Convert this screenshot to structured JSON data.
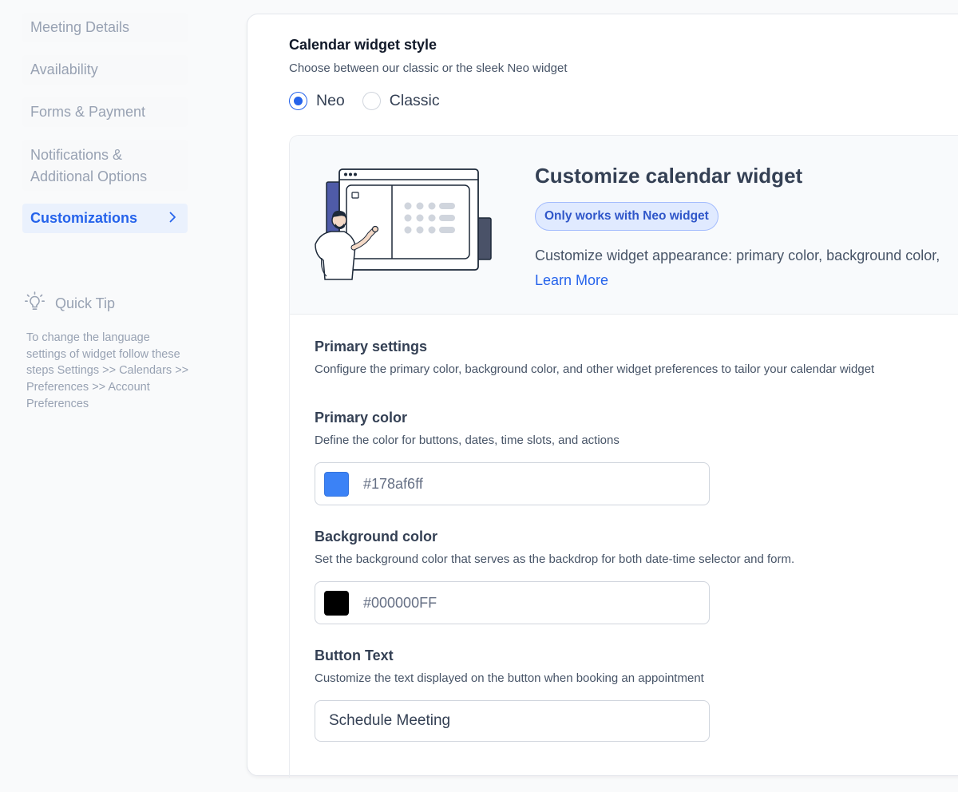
{
  "sidebar": {
    "items": [
      {
        "label": "Meeting Details"
      },
      {
        "label": "Availability"
      },
      {
        "label": "Forms & Payment"
      },
      {
        "label_line1": "Notifications &",
        "label_line2": "Additional Options"
      },
      {
        "label": "Customizations",
        "active": true
      }
    ]
  },
  "quick_tip": {
    "title": "Quick Tip",
    "body": "To change the language settings of widget follow these steps Settings >> Calendars >> Preferences >> Account Preferences"
  },
  "widget_style": {
    "title": "Calendar widget style",
    "subtitle": "Choose between our classic or the sleek Neo widget",
    "options": [
      {
        "label": "Neo",
        "selected": true
      },
      {
        "label": "Classic",
        "selected": false
      }
    ]
  },
  "hero": {
    "title": "Customize calendar widget",
    "badge": "Only works with Neo widget",
    "description": "Customize widget appearance: primary color, background color,",
    "learn_more": "Learn More"
  },
  "primary_settings": {
    "title": "Primary settings",
    "description": "Configure the primary color, background color, and other widget preferences to tailor your calendar widget"
  },
  "primary_color": {
    "title": "Primary color",
    "description": "Define the color for buttons, dates, time slots, and actions",
    "value": "#178af6ff",
    "swatch": "#3b82f6"
  },
  "background_color": {
    "title": "Background color",
    "description": "Set the background color that serves as the backdrop for both date-time selector and form.",
    "value": "#000000FF",
    "swatch": "#000000"
  },
  "button_text": {
    "title": "Button Text",
    "description": "Customize the text displayed on the button when booking an appointment",
    "value": "Schedule Meeting"
  }
}
